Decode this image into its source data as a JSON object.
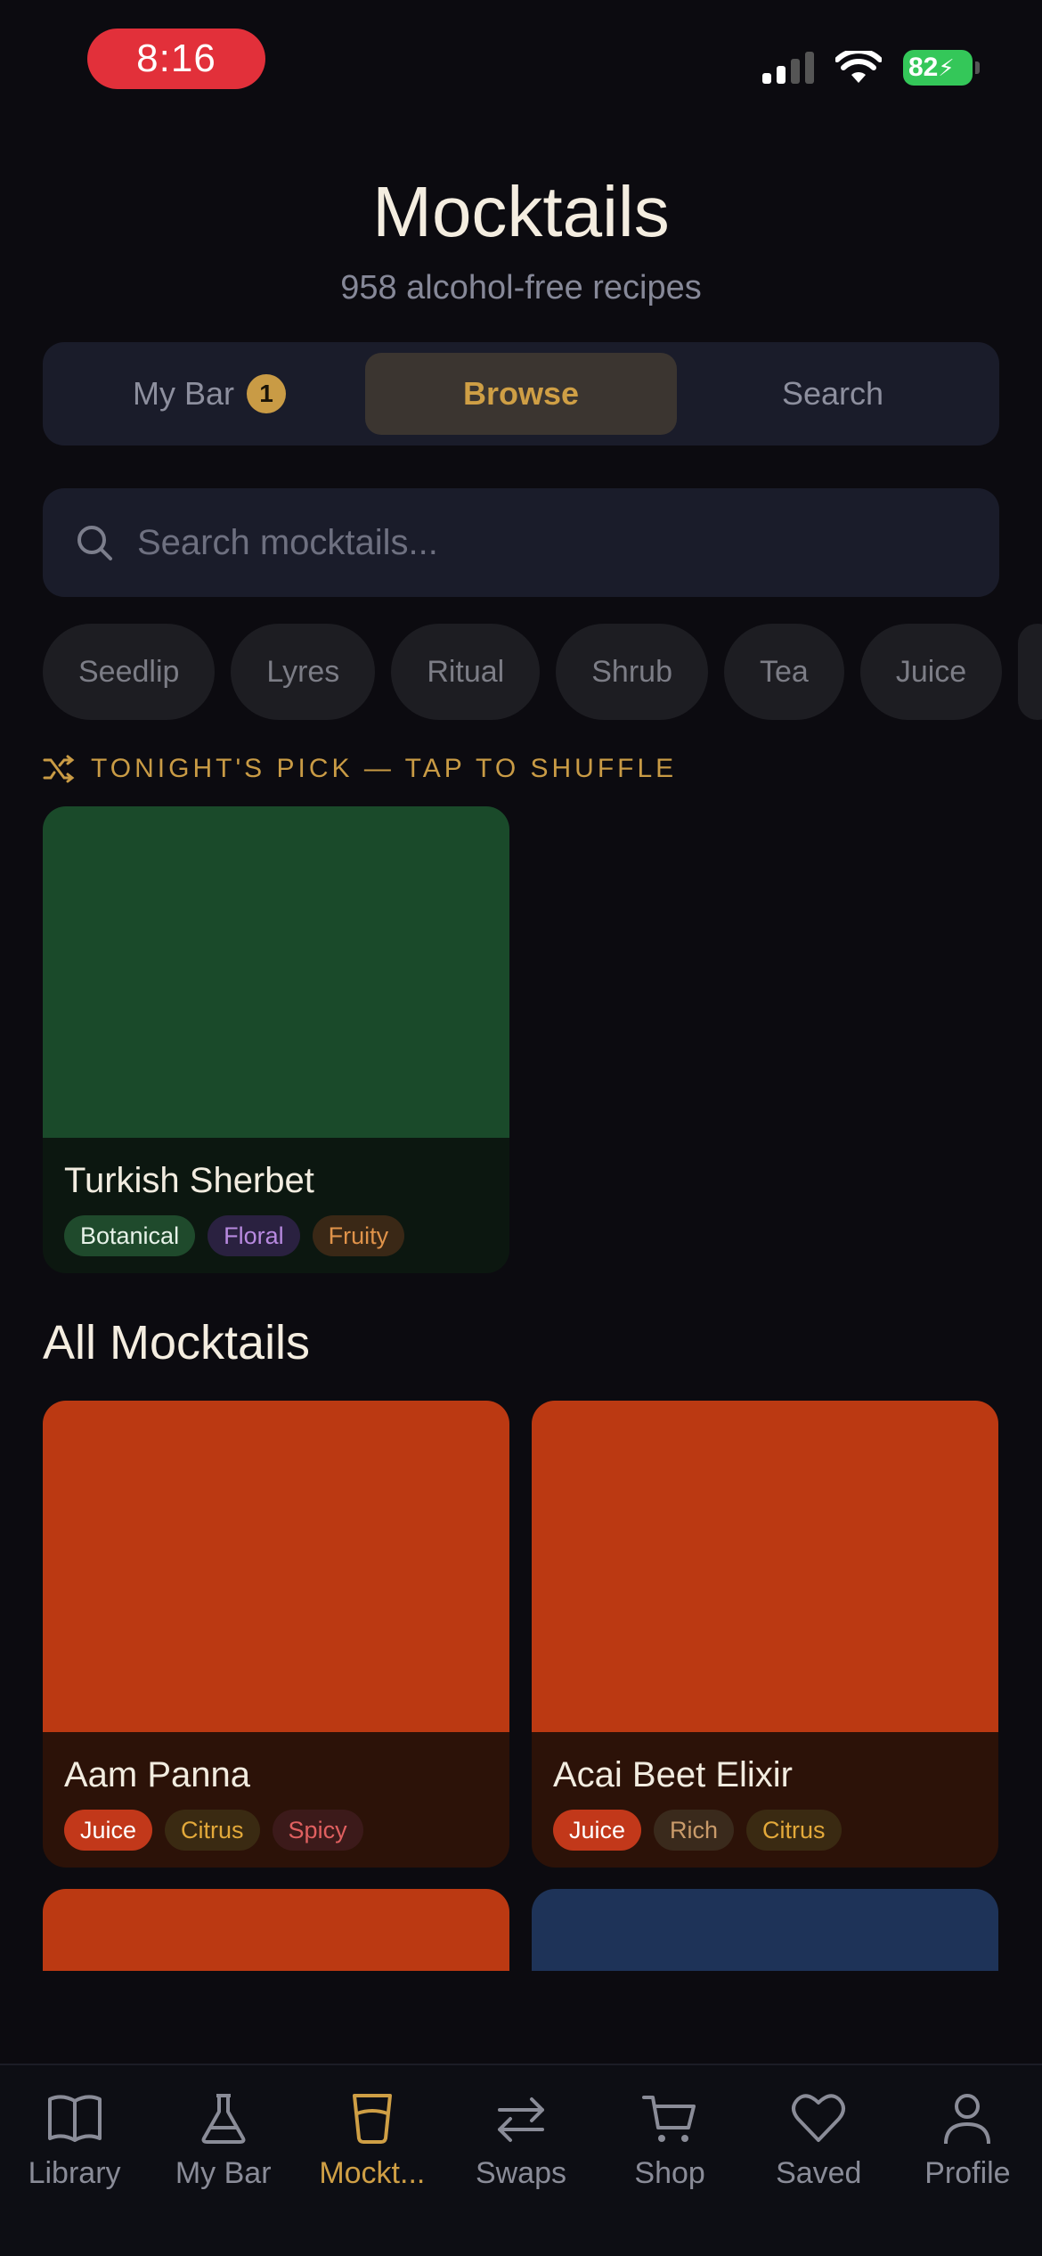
{
  "status_bar": {
    "time": "8:16",
    "battery": "82"
  },
  "header": {
    "title": "Mocktails",
    "subtitle": "958 alcohol-free recipes"
  },
  "segments": [
    {
      "label": "My Bar",
      "badge": "1"
    },
    {
      "label": "Browse"
    },
    {
      "label": "Search"
    }
  ],
  "search": {
    "placeholder": "Search mocktails..."
  },
  "chips": [
    "Seedlip",
    "Lyres",
    "Ritual",
    "Shrub",
    "Tea",
    "Juice"
  ],
  "tonight": {
    "label": "TONIGHT'S PICK — TAP TO SHUFFLE",
    "card": {
      "name": "Turkish Sherbet",
      "tags": [
        "Botanical",
        "Floral",
        "Fruity"
      ],
      "color": "#1a4a2a"
    }
  },
  "all": {
    "title": "All Mocktails",
    "cards": [
      {
        "name": "Aam Panna",
        "tags": [
          "Juice",
          "Citrus",
          "Spicy"
        ],
        "color": "#bb3912"
      },
      {
        "name": "Acai Beet Elixir",
        "tags": [
          "Juice",
          "Rich",
          "Citrus"
        ],
        "color": "#bb3912"
      },
      {
        "name": "",
        "tags": [],
        "color": "#bb3912"
      },
      {
        "name": "",
        "tags": [],
        "color": "#1e3358"
      }
    ]
  },
  "tabbar": [
    {
      "label": "Library",
      "icon": "book-icon"
    },
    {
      "label": "My Bar",
      "icon": "flask-icon"
    },
    {
      "label": "Mockt...",
      "icon": "glass-icon",
      "active": true
    },
    {
      "label": "Swaps",
      "icon": "swap-icon"
    },
    {
      "label": "Shop",
      "icon": "cart-icon"
    },
    {
      "label": "Saved",
      "icon": "heart-icon"
    },
    {
      "label": "Profile",
      "icon": "person-icon"
    }
  ],
  "colors": {
    "accent": "#c99b45",
    "background": "#0c0b10",
    "surface": "#1a1c2a"
  }
}
